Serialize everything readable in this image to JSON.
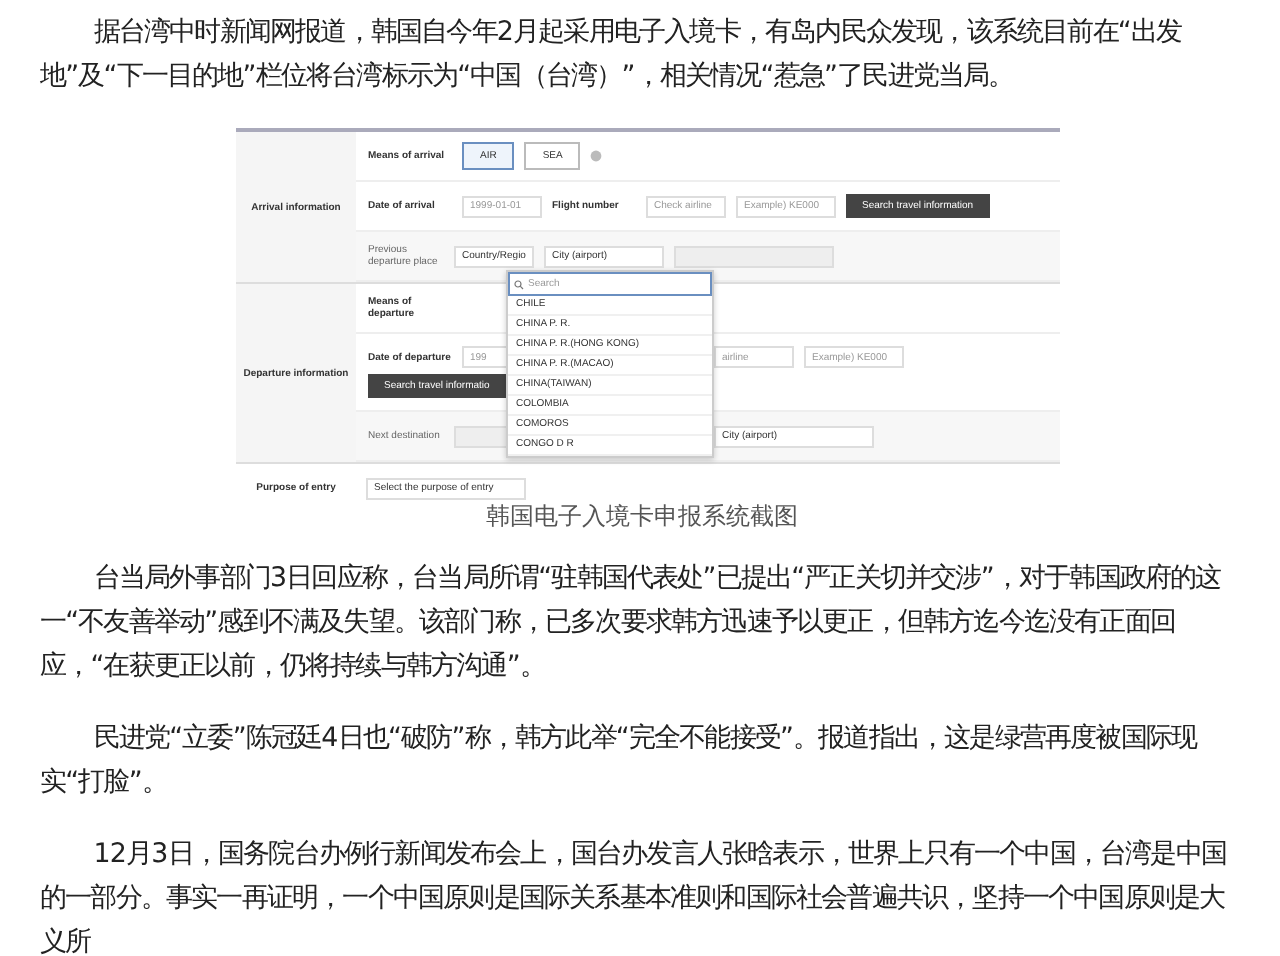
{
  "paragraphs_before": [
    "据台湾中时新闻网报道，韩国自今年2月起采用电子入境卡，有岛内民众发现，该系统目前在“出发地”及“下一目的地”栏位将台湾标示为“中国（台湾）”，相关情况“惹急”了民进党当局。"
  ],
  "figure": {
    "arrival": {
      "label": "Arrival information",
      "means_label": "Means of arrival",
      "means": [
        {
          "label": "AIR",
          "selected": true
        },
        {
          "label": "SEA",
          "selected": false
        }
      ],
      "date_label": "Date of arrival",
      "date_placeholder": "1999-01-01",
      "flight_label": "Flight number",
      "airline_placeholder": "Check airline",
      "flight_placeholder": "Example) KE000",
      "search_button": "Search travel information",
      "previous_label": "Previous departure place",
      "country_select": "Country/Regio",
      "city_select": "City (airport)"
    },
    "departure": {
      "label": "Departure information",
      "means_label": "Means of departure",
      "date_label": "Date of departure",
      "date_placeholder": "199",
      "airline_placeholder": "airline",
      "flight_placeholder": "Example) KE000",
      "search_button": "Search travel informatio",
      "next_label": "Next destination",
      "city_select": "City (airport)"
    },
    "purpose": {
      "label": "Purpose of entry",
      "select": "Select the purpose of entry"
    },
    "dropdown": {
      "search_placeholder": "Search",
      "options": [
        "CHILE",
        "CHINA P. R.",
        "CHINA P. R.(HONG KONG)",
        "CHINA P. R.(MACAO)",
        "CHINA(TAIWAN)",
        "COLOMBIA",
        "COMOROS",
        "CONGO D R"
      ]
    },
    "caption": "韩国电子入境卡申报系统截图"
  },
  "paragraphs_after": [
    "台当局外事部门3日回应称，台当局所谓“驻韩国代表处”已提出“严正关切并交涉”，对于韩国政府的这一“不友善举动”感到不满及失望。该部门称，已多次要求韩方迅速予以更正，但韩方迄今迄没有正面回应，“在获更正以前，仍将持续与韩方沟通”。",
    "民进党“立委”陈冠廷4日也“破防”称，韩方此举“完全不能接受”。报道指出，这是绿营再度被国际现实“打脸”。",
    "12月3日，国务院台办例行新闻发布会上，国台办发言人张晗表示，世界上只有一个中国，台湾是中国的一部分。事实一再证明，一个中国原则是国际关系基本准则和国际社会普遍共识，坚持一个中国原则是大义所"
  ]
}
